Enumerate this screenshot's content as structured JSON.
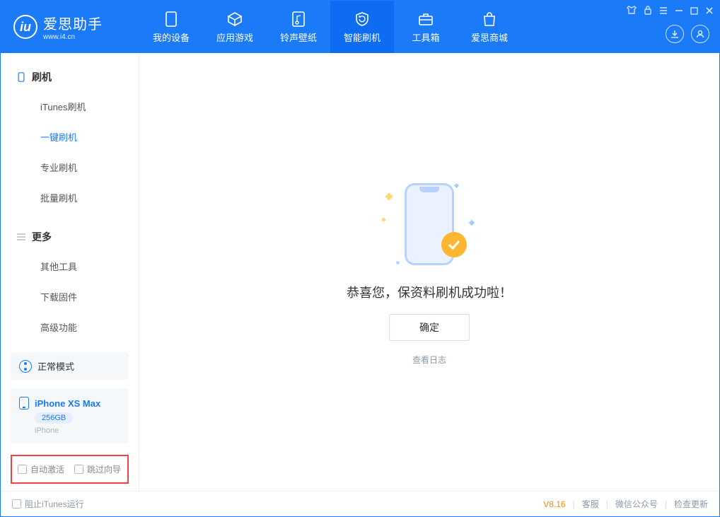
{
  "app": {
    "name": "爱思助手",
    "domain": "www.i4.cn"
  },
  "tabs": [
    {
      "label": "我的设备"
    },
    {
      "label": "应用游戏"
    },
    {
      "label": "铃声壁纸"
    },
    {
      "label": "智能刷机"
    },
    {
      "label": "工具箱"
    },
    {
      "label": "爱思商城"
    }
  ],
  "sidebar": {
    "section1": {
      "title": "刷机",
      "items": [
        "iTunes刷机",
        "一键刷机",
        "专业刷机",
        "批量刷机"
      ]
    },
    "section2": {
      "title": "更多",
      "items": [
        "其他工具",
        "下载固件",
        "高级功能"
      ]
    }
  },
  "mode": {
    "label": "正常模式"
  },
  "device": {
    "name": "iPhone XS Max",
    "storage": "256GB",
    "type": "iPhone"
  },
  "options": {
    "auto_activate": "自动激活",
    "skip_guide": "跳过向导"
  },
  "content": {
    "success": "恭喜您，保资料刷机成功啦！",
    "ok": "确定",
    "view_log": "查看日志"
  },
  "footer": {
    "block_itunes": "阻止iTunes运行",
    "version": "V8.16",
    "support": "客服",
    "wechat": "微信公众号",
    "update": "检查更新"
  }
}
